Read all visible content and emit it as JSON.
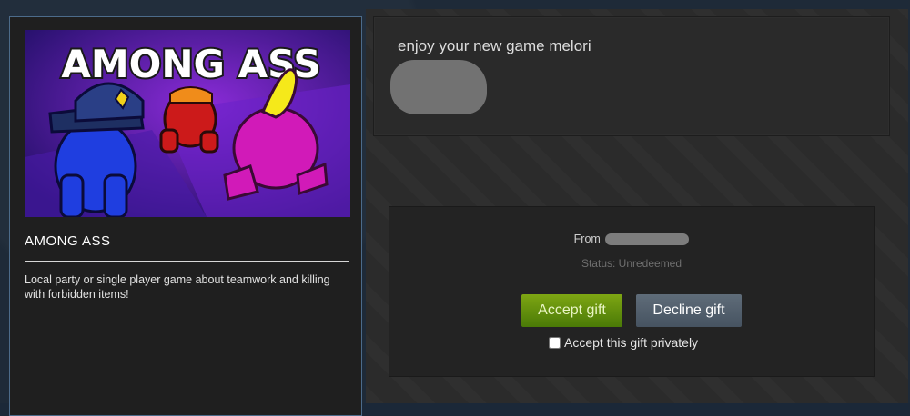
{
  "game": {
    "capsule_title": "AMONG ASS",
    "title": "AMONG ASS",
    "description": "Local party or single player game about teamwork and killing with forbidden items!"
  },
  "message": {
    "text": "enjoy your new game melori"
  },
  "gift": {
    "from_label": "From",
    "status": "Status: Unredeemed",
    "accept_label": "Accept gift",
    "decline_label": "Decline gift",
    "private_label": "Accept this gift privately",
    "private_checked": false
  },
  "colors": {
    "accept": "#5c8a0c",
    "decline": "#55626f",
    "panel": "#2a2a2a",
    "card_border": "#4c6b8a"
  }
}
